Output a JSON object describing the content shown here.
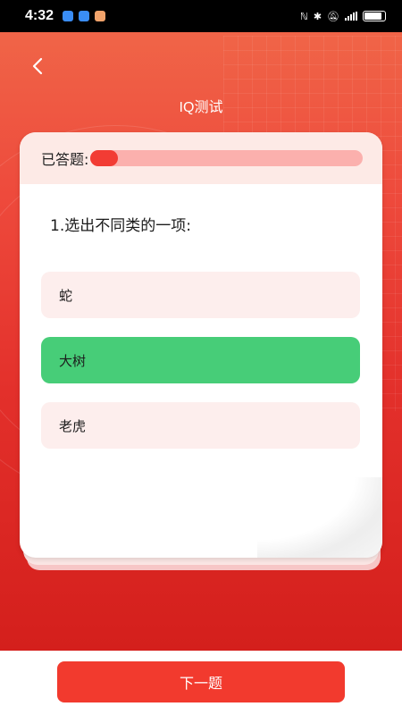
{
  "status_bar": {
    "time": "4:32",
    "notification_icons": [
      "app-icon-blue",
      "app-icon-blue",
      "message-icon"
    ],
    "network_label": "..ıll"
  },
  "header": {
    "title": "IQ测试"
  },
  "progress": {
    "label": "已答题:",
    "fraction": 0.1,
    "fill_color": "#f23c34",
    "track_color": "#fbb0ad"
  },
  "question": {
    "text": "1.选出不同类的一项:"
  },
  "options": [
    {
      "label": "蛇",
      "selected": false
    },
    {
      "label": "大树",
      "selected": true
    },
    {
      "label": "老虎",
      "selected": false
    }
  ],
  "colors": {
    "accent": "#f23a2e",
    "selected": "#47cd78",
    "option_bg": "#fdeeed"
  },
  "footer": {
    "next_label": "下一题"
  }
}
